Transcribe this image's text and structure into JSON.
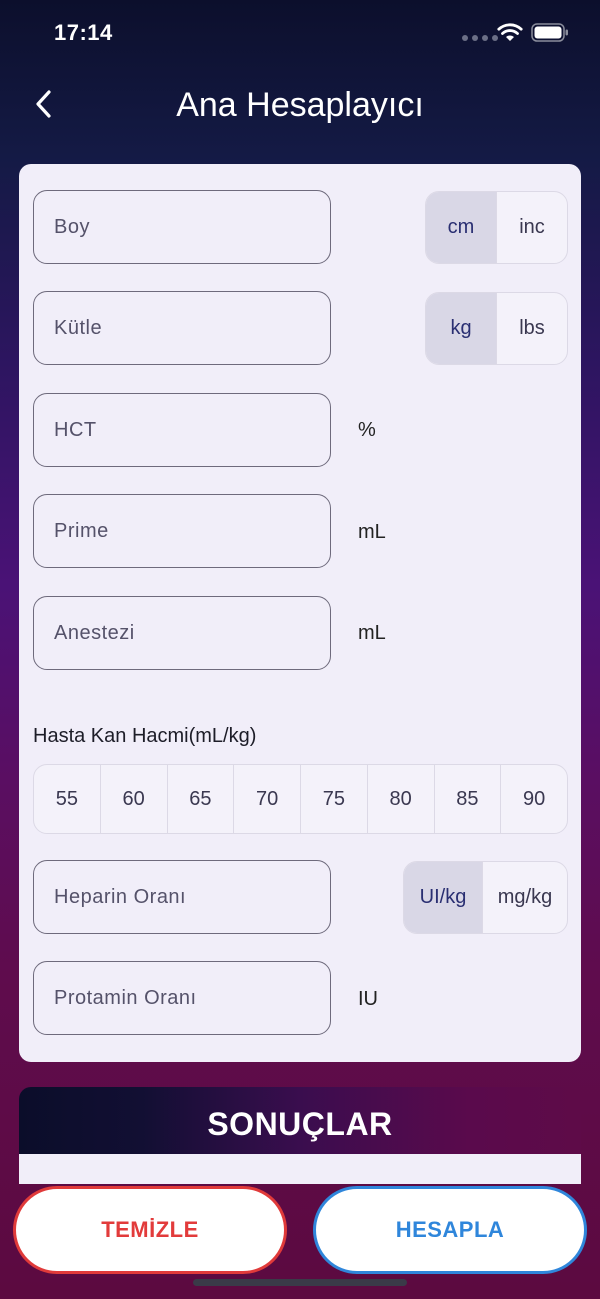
{
  "status_bar": {
    "time": "17:14"
  },
  "header": {
    "title": "Ana Hesaplayıcı"
  },
  "form": {
    "height": {
      "placeholder": "Boy",
      "units": [
        "cm",
        "inc"
      ],
      "selected": "cm"
    },
    "mass": {
      "placeholder": "Kütle",
      "units": [
        "kg",
        "lbs"
      ],
      "selected": "kg"
    },
    "hct": {
      "placeholder": "HCT",
      "unit": "%"
    },
    "prime": {
      "placeholder": "Prime",
      "unit": "mL"
    },
    "anesthesia": {
      "placeholder": "Anestezi",
      "unit": "mL"
    },
    "blood_volume": {
      "label": "Hasta Kan Hacmi(mL/kg)",
      "options": [
        "55",
        "60",
        "65",
        "70",
        "75",
        "80",
        "85",
        "90"
      ]
    },
    "heparin": {
      "placeholder": "Heparin Oranı",
      "units": [
        "UI/kg",
        "mg/kg"
      ],
      "selected": "UI/kg"
    },
    "protamin": {
      "placeholder": "Protamin Oranı",
      "unit": "IU"
    }
  },
  "results": {
    "title": "SONUÇLAR"
  },
  "actions": {
    "clear_label": "TEMİZLE",
    "calculate_label": "HESAPLA"
  },
  "colors": {
    "clear": "#e23b3b",
    "calculate": "#2f86db",
    "active_segment": "#d9d7e6",
    "card": "#f1eef9"
  }
}
